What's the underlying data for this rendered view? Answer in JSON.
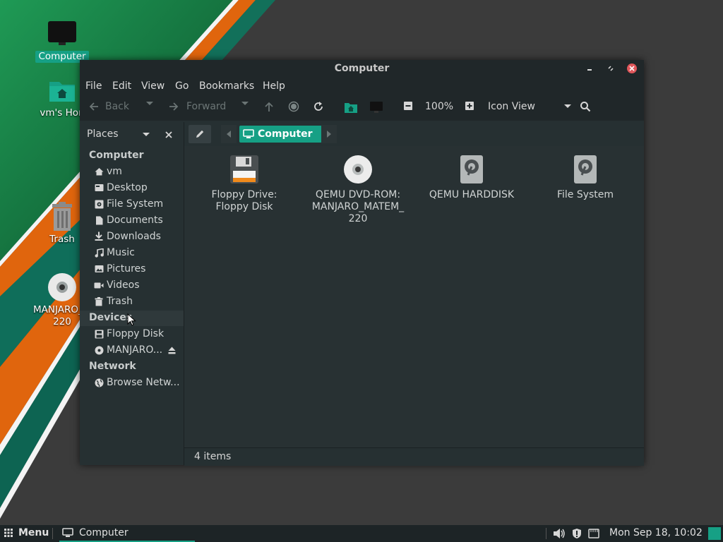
{
  "desktop": {
    "icons": [
      {
        "label": "Computer",
        "icon": "computer-icon",
        "selected": true
      },
      {
        "label": "vm's Hon",
        "icon": "home-folder-icon"
      },
      {
        "label": "Trash",
        "icon": "trash-icon"
      },
      {
        "label": "MANJARO_MA",
        "label2": "220",
        "icon": "optical-disc-icon"
      }
    ]
  },
  "window": {
    "title": "Computer",
    "menu": [
      "File",
      "Edit",
      "View",
      "Go",
      "Bookmarks",
      "Help"
    ],
    "toolbar": {
      "back_label": "Back",
      "forward_label": "Forward",
      "zoom": "100%",
      "view_mode": "Icon View"
    },
    "sidebar": {
      "header": "Places",
      "sections": [
        {
          "title": "Computer",
          "items": [
            {
              "label": "vm",
              "icon": "home-icon"
            },
            {
              "label": "Desktop",
              "icon": "desktop-icon"
            },
            {
              "label": "File System",
              "icon": "drive-icon"
            },
            {
              "label": "Documents",
              "icon": "document-icon"
            },
            {
              "label": "Downloads",
              "icon": "download-icon"
            },
            {
              "label": "Music",
              "icon": "music-icon"
            },
            {
              "label": "Pictures",
              "icon": "pictures-icon"
            },
            {
              "label": "Videos",
              "icon": "video-icon"
            },
            {
              "label": "Trash",
              "icon": "trash-icon"
            }
          ]
        },
        {
          "title": "Devices",
          "items": [
            {
              "label": "Floppy Disk",
              "icon": "floppy-icon"
            },
            {
              "label": "MANJARO...",
              "icon": "disc-icon",
              "eject": true
            }
          ]
        },
        {
          "title": "Network",
          "items": [
            {
              "label": "Browse Netw...",
              "icon": "network-icon"
            }
          ]
        }
      ]
    },
    "pathbar": {
      "current": "Computer"
    },
    "files": [
      {
        "line1": "Floppy Drive:",
        "line2": "Floppy Disk",
        "line3": "",
        "icon": "floppy-drive-icon"
      },
      {
        "line1": "QEMU DVD-ROM:",
        "line2": "MANJARO_MATEM_",
        "line3": "220",
        "icon": "dvd-rom-icon"
      },
      {
        "line1": "QEMU HARDDISK",
        "line2": "",
        "line3": "",
        "icon": "harddisk-icon"
      },
      {
        "line1": "File System",
        "line2": "",
        "line3": "",
        "icon": "filesystem-icon"
      }
    ],
    "status": "4 items"
  },
  "taskbar": {
    "menu_label": "Menu",
    "task_label": "Computer",
    "clock": "Mon Sep 18, 10:02"
  },
  "colors": {
    "accent": "#16a085",
    "window_bg": "#263032",
    "titlebar_bg": "#202729",
    "close_red": "#e0575b",
    "wallpaper_green": "#1e8f4e",
    "wallpaper_orange": "#e0650d"
  }
}
